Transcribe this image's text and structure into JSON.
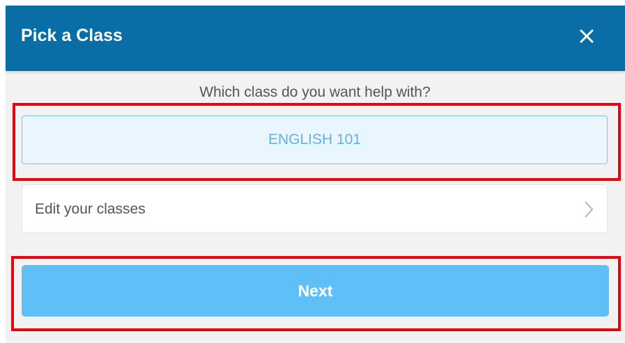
{
  "dialog": {
    "title": "Pick a Class",
    "close_icon": "close-icon",
    "question": "Which class do you want help with?",
    "classes": [
      {
        "label": "ENGLISH 101",
        "selected": true
      }
    ],
    "edit_label": "Edit your classes",
    "edit_icon": "chevron-right-icon",
    "next_label": "Next"
  },
  "colors": {
    "header": "#0a6ea6",
    "background": "#f2f2f2",
    "selected_bg": "#eaf6fd",
    "selected_border": "#7ec3ea",
    "selected_text": "#5cb4e6",
    "next_button": "#5ec0f6",
    "highlight": "#e8000b"
  }
}
